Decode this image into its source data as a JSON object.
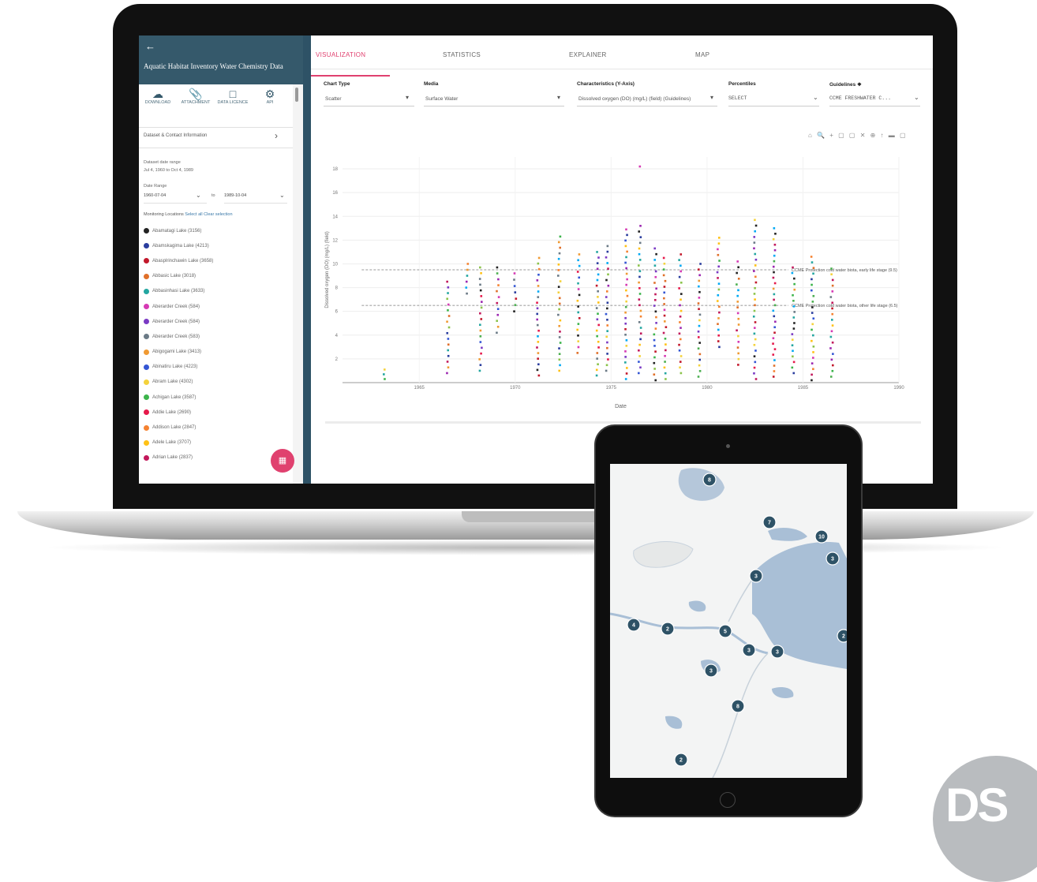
{
  "sidebar": {
    "title": "Aquatic Habitat Inventory Water Chemistry Data",
    "actions": [
      {
        "label": "DOWNLOAD",
        "icon": "cloud-download-icon"
      },
      {
        "label": "ATTACHMENT",
        "icon": "paperclip-icon"
      },
      {
        "label": "DATA LICENCE",
        "icon": "document-icon"
      },
      {
        "label": "API",
        "icon": "gear-icon"
      }
    ],
    "contact_label": "Dataset & Contact Information",
    "date_range_label": "Dataset date range",
    "date_range_value": "Jul 4, 1960 to Oct 4, 1989",
    "date_filter_label": "Date Range",
    "date_from": "1960-07-04",
    "date_to_label": "to",
    "date_to": "1989-10-04",
    "locations_label": "Monitoring Locations",
    "select_all": "Select all",
    "clear_selection": "Clear selection",
    "locations": [
      {
        "name": "Abamatagi Lake (3156)",
        "color": "#222222"
      },
      {
        "name": "Abamskagima Lake (4213)",
        "color": "#2a3d9e"
      },
      {
        "name": "Abasplrinchawin Lake (3658)",
        "color": "#c2182b"
      },
      {
        "name": "Abbasic Lake (3018)",
        "color": "#e0702a"
      },
      {
        "name": "Abbasinhasi Lake (3633)",
        "color": "#23a6a0"
      },
      {
        "name": "Aberarder Creek (584)",
        "color": "#d63ab4"
      },
      {
        "name": "Aberarder Creek (584)",
        "color": "#7a3ac4"
      },
      {
        "name": "Aberarder Creek (583)",
        "color": "#6b7a86"
      },
      {
        "name": "Abigogami Lake (3413)",
        "color": "#f09a33"
      },
      {
        "name": "Abinatiru Lake (4223)",
        "color": "#3456d4"
      },
      {
        "name": "Abram Lake (4302)",
        "color": "#f4d23c"
      },
      {
        "name": "Achigan Lake (3587)",
        "color": "#3cb44b"
      },
      {
        "name": "Addie Lake (2690)",
        "color": "#e6194b"
      },
      {
        "name": "Addison Lake (2847)",
        "color": "#f58231"
      },
      {
        "name": "Adele Lake (3707)",
        "color": "#ffc116"
      },
      {
        "name": "Adrian Lake (2837)",
        "color": "#c2185b"
      }
    ],
    "fab_icon": "map-icon"
  },
  "tabs": [
    {
      "label": "VISUALIZATION",
      "active": true
    },
    {
      "label": "STATISTICS",
      "active": false
    },
    {
      "label": "EXPLAINER",
      "active": false
    },
    {
      "label": "MAP",
      "active": false
    }
  ],
  "filters": {
    "chart_type_label": "Chart Type",
    "chart_type_value": "Scatter",
    "media_label": "Media",
    "media_value": "Surface Water",
    "characteristics_label": "Characteristics (Y-Axis)",
    "characteristics_value": "Dissolved oxygen (DO) (mg/L) (field) (Guidelines)",
    "percentiles_label": "Percentiles",
    "percentiles_value": "SELECT",
    "guidelines_label": "Guidelines",
    "guidelines_value": "CCME FRESHWATER C..."
  },
  "chart_data": {
    "type": "scatter",
    "title": "",
    "xlabel": "Date",
    "ylabel": "Dissolved oxygen (DO) (mg/L) (field)",
    "xlim": [
      1961,
      1990
    ],
    "ylim": [
      0,
      19
    ],
    "x_ticks": [
      "1965",
      "1970",
      "1975",
      "1980",
      "1985",
      "1990"
    ],
    "y_ticks": [
      "2",
      "4",
      "6",
      "8",
      "10",
      "12",
      "14",
      "16",
      "18"
    ],
    "grid": true,
    "guidelines": [
      {
        "label": "CCME Protection cold water biota, early life stage (9.5)",
        "value": 9.5
      },
      {
        "label": "CCME Protection cold water biota, other life stage (6.5)",
        "value": 6.5
      }
    ],
    "columns": [
      {
        "x": 1963.2,
        "min": 0.3,
        "max": 1.1
      },
      {
        "x": 1966.5,
        "min": 0.8,
        "max": 8.5
      },
      {
        "x": 1967.5,
        "min": 7.5,
        "max": 10.0
      },
      {
        "x": 1968.2,
        "min": 1.0,
        "max": 9.7
      },
      {
        "x": 1969.1,
        "min": 4.2,
        "max": 9.7
      },
      {
        "x": 1970.0,
        "min": 6.0,
        "max": 9.2
      },
      {
        "x": 1971.2,
        "min": 0.6,
        "max": 10.5
      },
      {
        "x": 1972.3,
        "min": 1.0,
        "max": 12.3
      },
      {
        "x": 1973.3,
        "min": 2.5,
        "max": 10.8
      },
      {
        "x": 1974.3,
        "min": 0.6,
        "max": 11.0
      },
      {
        "x": 1974.8,
        "min": 1.0,
        "max": 11.5
      },
      {
        "x": 1975.8,
        "min": 0.3,
        "max": 12.9
      },
      {
        "x": 1976.5,
        "min": 0.8,
        "max": 13.2
      },
      {
        "x": 1977.3,
        "min": 0.2,
        "max": 11.3
      },
      {
        "x": 1977.8,
        "min": 0.3,
        "max": 10.5
      },
      {
        "x": 1978.6,
        "min": 0.8,
        "max": 10.8
      },
      {
        "x": 1979.6,
        "min": 0.5,
        "max": 10.0
      },
      {
        "x": 1980.6,
        "min": 3.0,
        "max": 12.2
      },
      {
        "x": 1981.6,
        "min": 1.5,
        "max": 10.2
      },
      {
        "x": 1982.5,
        "min": 0.3,
        "max": 13.7
      },
      {
        "x": 1983.5,
        "min": 0.5,
        "max": 13.0
      },
      {
        "x": 1984.5,
        "min": 0.8,
        "max": 9.7
      },
      {
        "x": 1985.5,
        "min": 0.2,
        "max": 10.6
      },
      {
        "x": 1986.5,
        "min": 0.5,
        "max": 9.6
      }
    ],
    "outliers": [
      {
        "x": 1976.5,
        "y": 18.2
      }
    ]
  },
  "chart_toolbar": "⌂ 🔍 + ▢ ▢ ✕ ⊕ ↑ ▬ ▢",
  "tablet_map": {
    "markers": [
      "8",
      "7",
      "10",
      "3",
      "3",
      "4",
      "2",
      "5",
      "2",
      "3",
      "3",
      "3",
      "8",
      "2"
    ]
  },
  "watermark": "DS",
  "colors": {
    "header": "#35596b",
    "accent": "#e0416f",
    "map_water": "#a9bfd6",
    "marker": "#2e5266"
  }
}
